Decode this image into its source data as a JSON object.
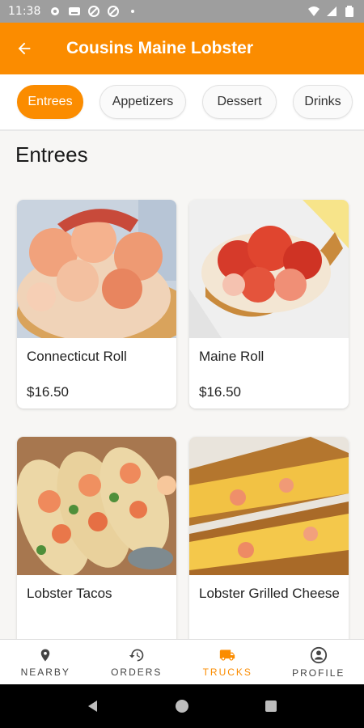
{
  "status_bar": {
    "time": "11:38"
  },
  "app_bar": {
    "title": "Cousins Maine Lobster"
  },
  "tabs": [
    {
      "label": "Entrees",
      "active": true
    },
    {
      "label": "Appetizers",
      "active": false
    },
    {
      "label": "Dessert",
      "active": false
    },
    {
      "label": "Drinks",
      "active": false
    }
  ],
  "section": {
    "title": "Entrees"
  },
  "items": [
    {
      "name": "Connecticut Roll",
      "price": "$16.50"
    },
    {
      "name": "Maine Roll",
      "price": "$16.50"
    },
    {
      "name": "Lobster Tacos",
      "price": ""
    },
    {
      "name": "Lobster Grilled Cheese",
      "price": ""
    }
  ],
  "bottom_nav": [
    {
      "label": "NEARBY",
      "icon": "location-pin-icon"
    },
    {
      "label": "ORDERS",
      "icon": "history-icon"
    },
    {
      "label": "TRUCKS",
      "icon": "truck-icon"
    },
    {
      "label": "PROFILE",
      "icon": "profile-icon"
    }
  ],
  "colors": {
    "accent": "#fb8c00",
    "background": "#f7f6f4",
    "status_bar": "#9e9e9e"
  }
}
